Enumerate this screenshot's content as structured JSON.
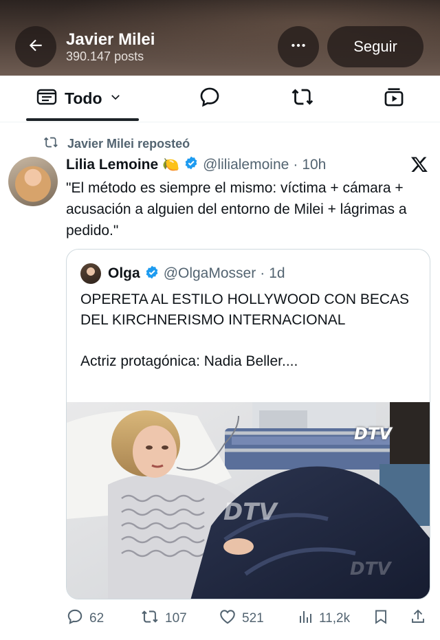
{
  "header": {
    "profile_name": "Javier Milei",
    "posts_count": "390.147 posts",
    "follow_label": "Seguir"
  },
  "tabs": {
    "active_label": "Todo"
  },
  "post": {
    "repost_label": "Javier Milei reposteó",
    "author_name": "Lilia Lemoine",
    "author_emoji": "🍋",
    "author_handle": "@lilialemoine",
    "separator": "·",
    "time": "10h",
    "text": "\"El método es siempre el mismo: víctima + cámara + acusación a alguien del entorno de Milei + lágrimas a pedido.\"",
    "quote": {
      "name": "Olga",
      "handle": "@OlgaMosser",
      "time": "1d",
      "text": "OPERETA AL ESTILO HOLLYWOOD CON BECAS DEL KIRCHNERISMO INTERNACIONAL\n\nActriz protagónica: Nadia Beller....",
      "watermark": "DTV"
    },
    "actions": {
      "replies": "62",
      "reposts": "107",
      "likes": "521",
      "views": "11,2k"
    }
  },
  "colors": {
    "verified": "#1d9bf0",
    "text_primary": "#0f1419",
    "text_secondary": "#536471",
    "border": "#cfd9de"
  }
}
